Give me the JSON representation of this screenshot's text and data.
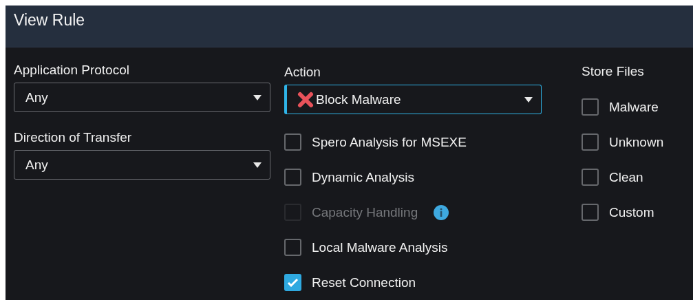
{
  "window": {
    "title": "View Rule"
  },
  "left_fields": [
    {
      "label": "Application Protocol",
      "value": "Any",
      "focused": false
    },
    {
      "label": "Direction of Transfer",
      "value": "Any",
      "focused": false
    }
  ],
  "action": {
    "label": "Action",
    "value": "Block Malware",
    "focused": true
  },
  "action_options": [
    {
      "label": "Spero Analysis for MSEXE",
      "checked": false,
      "disabled": false,
      "info": false
    },
    {
      "label": "Dynamic Analysis",
      "checked": false,
      "disabled": false,
      "info": false
    },
    {
      "label": "Capacity Handling",
      "checked": false,
      "disabled": true,
      "info": true
    },
    {
      "label": "Local Malware Analysis",
      "checked": false,
      "disabled": false,
      "info": false
    },
    {
      "label": "Reset Connection",
      "checked": true,
      "disabled": false,
      "info": false
    }
  ],
  "store_files": {
    "label": "Store Files",
    "options": [
      {
        "label": "Malware",
        "checked": false
      },
      {
        "label": "Unknown",
        "checked": false
      },
      {
        "label": "Clean",
        "checked": false
      },
      {
        "label": "Custom",
        "checked": false
      }
    ]
  }
}
